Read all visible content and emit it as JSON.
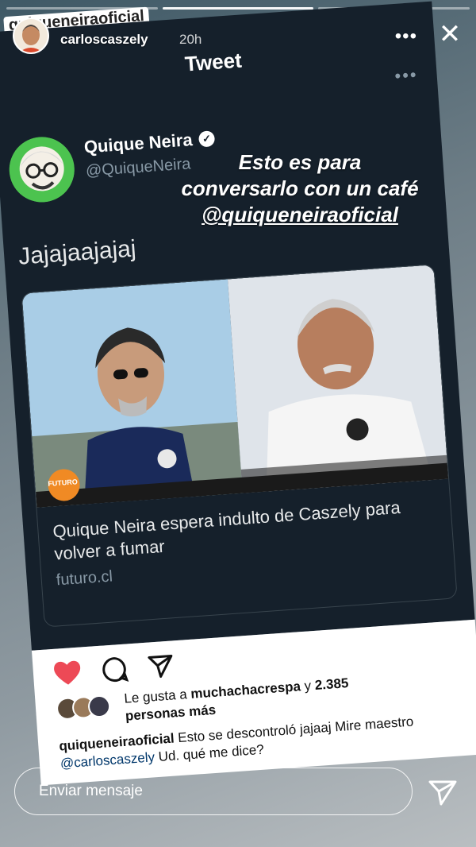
{
  "story": {
    "progress": {
      "segments": 3,
      "active_index": 1
    },
    "username": "carloscaszely",
    "time": "20h",
    "more_label": "•••",
    "close_label": "✕",
    "reply_placeholder": "Enviar mensaje"
  },
  "overlay": {
    "line1": "Esto es para",
    "line2": "conversarlo con un café",
    "mention": "@quiqueneiraoficial"
  },
  "post_header_partial": "quiqueneiraoficial",
  "tweet": {
    "title": "Tweet",
    "dots": "•••",
    "author_name": "Quique Neira",
    "author_handle": "@QuiqueNeira",
    "text": "Jajajaajajaj",
    "card": {
      "title": "Quique Neira espera indulto de Caszely para volver a fumar",
      "domain": "futuro.cl",
      "logo_text": "FUTURO"
    }
  },
  "instagram": {
    "likes_prefix": "Le gusta a ",
    "likes_user": "muchachacrespa",
    "likes_mid": " y ",
    "likes_count": "2.385",
    "likes_suffix": "personas más",
    "caption_user": "quiqueneiraoficial",
    "caption_text": " Esto se descontroló jajaaj Mire maestro ",
    "caption_mention": "@carloscaszely",
    "caption_end": " Ud. qué me dice?"
  },
  "colors": {
    "twitter_bg": "#15202b",
    "twitter_muted": "#8899a6",
    "like_red": "#ed4956",
    "avatar_green": "#4cc34f"
  }
}
